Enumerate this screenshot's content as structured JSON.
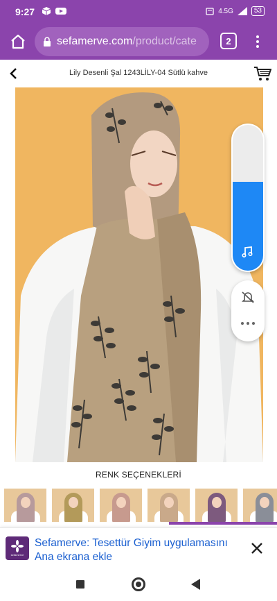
{
  "status_bar": {
    "time": "9:27",
    "network": "4.5G",
    "battery": "53",
    "icons": [
      "box-icon",
      "youtube-icon",
      "signal-icon",
      "battery-icon"
    ]
  },
  "browser": {
    "url_domain": "sefamerve.com",
    "url_path": "/product/cate",
    "tab_count": "2",
    "accent_color": "#8b44ac"
  },
  "page": {
    "product_title": "Lily Desenli Şal 1243LİLY-04 Sütlü kahve",
    "colors_heading": "RENK SEÇENEKLERİ"
  },
  "color_options": [
    {
      "name": "option-1",
      "scarf_color": "#b79a9c"
    },
    {
      "name": "option-2",
      "scarf_color": "#b39a5a"
    },
    {
      "name": "option-3",
      "scarf_color": "#c79a8e"
    },
    {
      "name": "option-4",
      "scarf_color": "#c9a98a"
    },
    {
      "name": "option-5",
      "scarf_color": "#7d5a7e"
    },
    {
      "name": "option-6",
      "scarf_color": "#8a8e98"
    }
  ],
  "volume_overlay": {
    "level_fraction": 0.61,
    "fill_color": "#1e88f5"
  },
  "install_banner": {
    "text": "Sefamerve: Tesettür Giyim uygulamasını Ana ekrana ekle",
    "app_icon_label": "sefamerve"
  }
}
